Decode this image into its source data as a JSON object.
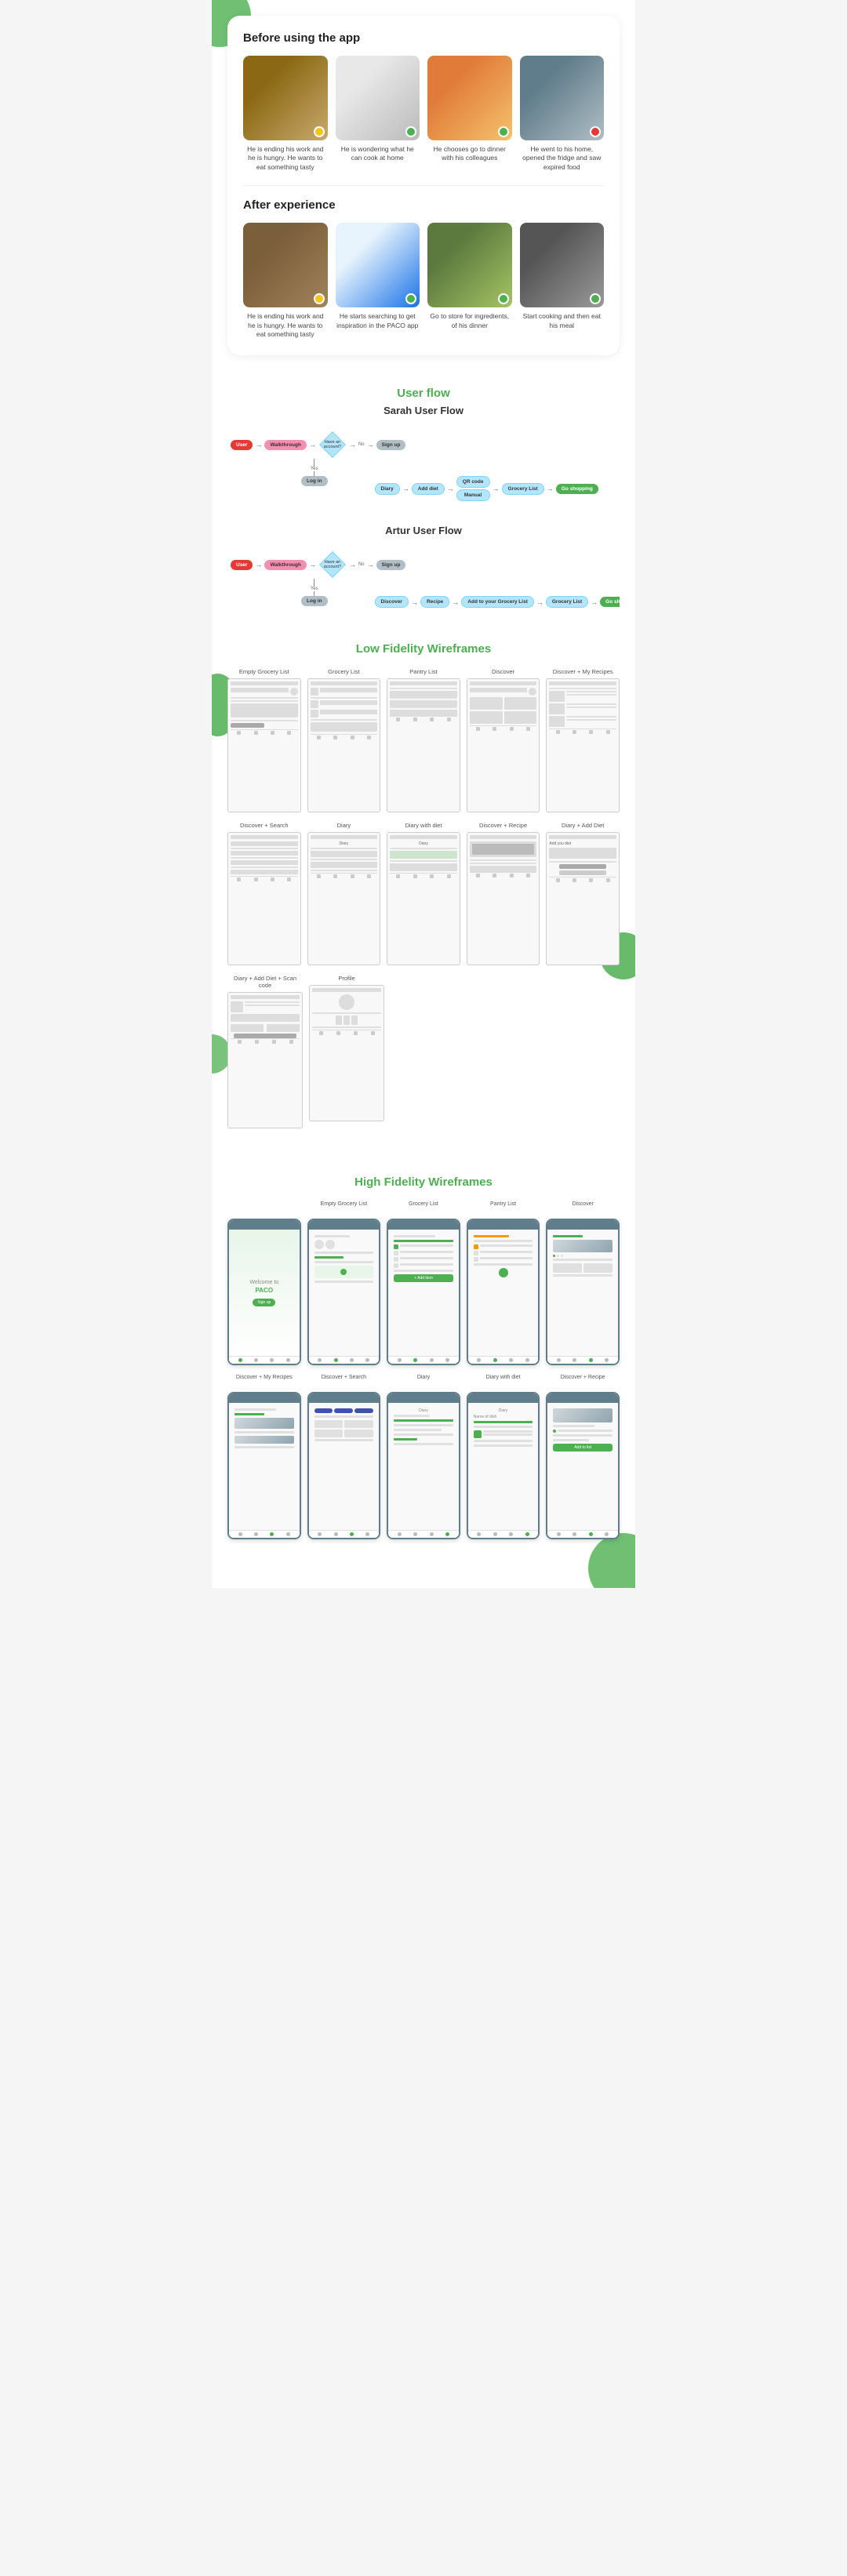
{
  "page": {
    "bg_color": "#f5f5f5"
  },
  "experience": {
    "before_heading": "Before using the app",
    "after_heading": "After experience",
    "before_items": [
      {
        "caption": "He is ending his work and he is hungry. He wants to eat something tasty",
        "badge": "yellow",
        "photo_class": "photo-man-laptop"
      },
      {
        "caption": "He is wondering what he can cook at home",
        "badge": "green",
        "photo_class": "photo-man-white"
      },
      {
        "caption": "He chooses go to dinner with his colleagues",
        "badge": "green",
        "photo_class": "photo-food-bowl"
      },
      {
        "caption": "He went to his home, opened the fridge and saw expired food",
        "badge": "red",
        "photo_class": "photo-fridge"
      }
    ],
    "after_items": [
      {
        "caption": "He is ending his work and he is hungry. He wants to eat something tasty",
        "badge": "yellow",
        "photo_class": "photo-man-laptop2"
      },
      {
        "caption": "He starts searching to get inspiration in the PACO app",
        "badge": "green",
        "photo_class": "photo-phone-app"
      },
      {
        "caption": "Go to store for ingredients, of his dinner",
        "badge": "green",
        "photo_class": "photo-market"
      },
      {
        "caption": "Start cooking and then eat his meal",
        "badge": "green",
        "photo_class": "photo-cooking"
      }
    ]
  },
  "userflow": {
    "section_title": "User flow",
    "sarah_title": "Sarah User Flow",
    "artur_title": "Artur User Flow",
    "sarah_nodes": {
      "user": "User",
      "walkthrough": "Walkthrough",
      "have_account": "Have an account?",
      "no": "No",
      "sign_up": "Sign up",
      "yes": "Yes",
      "log_in": "Log in",
      "diary": "Diary",
      "add_diet": "Add diet",
      "qr_code": "QR code",
      "manual": "Manual",
      "grocery_list": "Grocery List",
      "go_shopping": "Go shopping"
    },
    "artur_nodes": {
      "user": "User",
      "walkthrough": "Walkthrough",
      "have_account": "Have an account?",
      "no": "No",
      "sign_up": "Sign up",
      "yes": "Yes",
      "log_in": "Log in",
      "discover": "Discover",
      "recipe": "Recipe",
      "add_grocery": "Add to your Grocery List",
      "grocery_list": "Grocery List",
      "go_shopping": "Go shopping"
    }
  },
  "low_fidelity": {
    "section_title": "Low Fidelity Wireframes",
    "row1": [
      {
        "label": "Empty Grocery List"
      },
      {
        "label": "Grocery List"
      },
      {
        "label": "Pantry List"
      },
      {
        "label": "Discover"
      },
      {
        "label": "Discover + My Recipes"
      }
    ],
    "row2": [
      {
        "label": "Discover + Search"
      },
      {
        "label": "Diary"
      },
      {
        "label": "Diary with diet"
      },
      {
        "label": "Discover + Recipe"
      },
      {
        "label": "Diary + Add Diet"
      }
    ],
    "row3": [
      {
        "label": "Diary + Add Diet + Scan code"
      },
      {
        "label": "Profile"
      }
    ]
  },
  "high_fidelity": {
    "section_title": "High Fidelity Wireframes",
    "row1": [
      {
        "label": ""
      },
      {
        "label": "Empty Grocery List"
      },
      {
        "label": "Grocery List"
      },
      {
        "label": "Pantry List"
      },
      {
        "label": "Discover"
      }
    ],
    "row2": [
      {
        "label": "Discover + My Recipes"
      },
      {
        "label": "Discover + Search"
      },
      {
        "label": "Diary"
      },
      {
        "label": "Diary with diet"
      },
      {
        "label": "Discover + Recipe"
      }
    ]
  }
}
